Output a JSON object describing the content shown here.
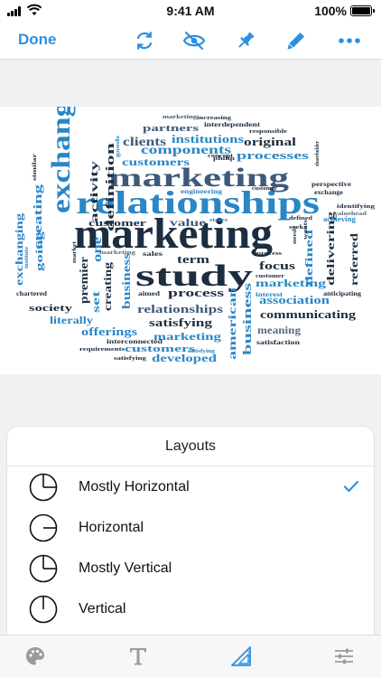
{
  "status_bar": {
    "time": "9:41 AM",
    "battery_percent": "100%",
    "battery_level": 1.0
  },
  "toolbar": {
    "done_label": "Done",
    "icons": [
      "refresh-icon",
      "eye-slash-icon",
      "pin-icon",
      "pen-icon",
      "more-icon"
    ],
    "accent_color": "#2d8fe0"
  },
  "word_cloud": {
    "palette": [
      "#2a86c5",
      "#1c2d40",
      "#5a6a7a",
      "#6a94b8",
      "#3d5a7a"
    ],
    "words": [
      {
        "t": "marketing",
        "s": 48
      },
      {
        "t": "relationships",
        "s": 36
      },
      {
        "t": "marketing",
        "s": 30
      },
      {
        "t": "study",
        "s": 34
      },
      {
        "t": "exchange",
        "s": 30
      },
      {
        "t": "components",
        "s": 14
      },
      {
        "t": "institutions",
        "s": 13
      },
      {
        "t": "partners",
        "s": 11
      },
      {
        "t": "clients",
        "s": 14
      },
      {
        "t": "original",
        "s": 13
      },
      {
        "t": "processes",
        "s": 13
      },
      {
        "t": "customers",
        "s": 12
      },
      {
        "t": "definition",
        "s": 13
      },
      {
        "t": "activity",
        "s": 12
      },
      {
        "t": "customer",
        "s": 11
      },
      {
        "t": "value",
        "s": 12
      },
      {
        "t": "creating",
        "s": 13
      },
      {
        "t": "going",
        "s": 11
      },
      {
        "t": "exchanging",
        "s": 12
      },
      {
        "t": "one",
        "s": 14
      },
      {
        "t": "premier",
        "s": 13
      },
      {
        "t": "set",
        "s": 12
      },
      {
        "t": "creating",
        "s": 12
      },
      {
        "t": "business",
        "s": 13
      },
      {
        "t": "term",
        "s": 13
      },
      {
        "t": "process",
        "s": 13
      },
      {
        "t": "relationships",
        "s": 13
      },
      {
        "t": "satisfying",
        "s": 13
      },
      {
        "t": "offerings",
        "s": 13
      },
      {
        "t": "marketing",
        "s": 12
      },
      {
        "t": "customers",
        "s": 11
      },
      {
        "t": "developed",
        "s": 12
      },
      {
        "t": "american",
        "s": 12
      },
      {
        "t": "business",
        "s": 13
      },
      {
        "t": "focus",
        "s": 13
      },
      {
        "t": "defined",
        "s": 12
      },
      {
        "t": "marketing",
        "s": 12
      },
      {
        "t": "delivering",
        "s": 12
      },
      {
        "t": "referred",
        "s": 12
      },
      {
        "t": "association",
        "s": 13
      },
      {
        "t": "communicating",
        "s": 13
      },
      {
        "t": "meaning",
        "s": 12
      },
      {
        "t": "society",
        "s": 11
      },
      {
        "t": "literally",
        "s": 12
      },
      {
        "t": "chartered",
        "s": 7
      },
      {
        "t": "achieving",
        "s": 8
      },
      {
        "t": "exchange",
        "s": 7
      },
      {
        "t": "perspective",
        "s": 7
      },
      {
        "t": "satisfaction",
        "s": 7
      },
      {
        "t": "anticipating",
        "s": 7
      },
      {
        "t": "interconnected",
        "s": 7
      },
      {
        "t": "requirements",
        "s": 6
      },
      {
        "t": "satisfying",
        "s": 6
      },
      {
        "t": "engineering",
        "s": 7
      },
      {
        "t": "interdependent",
        "s": 7
      },
      {
        "t": "responsible",
        "s": 6
      },
      {
        "t": "marketing",
        "s": 6
      },
      {
        "t": "increasing",
        "s": 6
      },
      {
        "t": "shareholder",
        "s": 6
      },
      {
        "t": "identifying",
        "s": 6
      },
      {
        "t": "valuehead",
        "s": 6
      },
      {
        "t": "institute",
        "s": 6
      },
      {
        "t": "similar",
        "s": 6
      },
      {
        "t": "sales",
        "s": 7
      },
      {
        "t": "aimed",
        "s": 7
      },
      {
        "t": "interest",
        "s": 7
      },
      {
        "t": "states",
        "s": 6
      },
      {
        "t": "philip",
        "s": 6
      },
      {
        "t": "concept",
        "s": 6
      },
      {
        "t": "customer",
        "s": 6
      },
      {
        "t": "defined",
        "s": 6
      },
      {
        "t": "goods",
        "s": 6
      },
      {
        "t": "needs",
        "s": 6
      },
      {
        "t": "wants",
        "s": 6
      },
      {
        "t": "seeks",
        "s": 6
      },
      {
        "t": "process",
        "s": 6
      },
      {
        "t": "customer",
        "s": 6
      },
      {
        "t": "market",
        "s": 6
      },
      {
        "t": "marketing",
        "s": 6
      },
      {
        "t": "satisfying",
        "s": 6
      }
    ]
  },
  "layouts_sheet": {
    "title": "Layouts",
    "selected_index": 0,
    "options": [
      {
        "label": "Mostly Horizontal",
        "icon": "mostly-horizontal-icon"
      },
      {
        "label": "Horizontal",
        "icon": "horizontal-icon"
      },
      {
        "label": "Mostly Vertical",
        "icon": "mostly-vertical-icon"
      },
      {
        "label": "Vertical",
        "icon": "vertical-icon"
      }
    ],
    "check_color": "#2d8fe0"
  },
  "tab_bar": {
    "tabs": [
      {
        "name": "palette",
        "icon": "palette-icon",
        "active": false
      },
      {
        "name": "font",
        "icon": "text-icon",
        "active": false
      },
      {
        "name": "layout",
        "icon": "triangle-ruler-icon",
        "active": true
      },
      {
        "name": "settings",
        "icon": "sliders-icon",
        "active": false
      }
    ],
    "active_color": "#2d8fe0",
    "inactive_color": "#9a9aa0"
  }
}
